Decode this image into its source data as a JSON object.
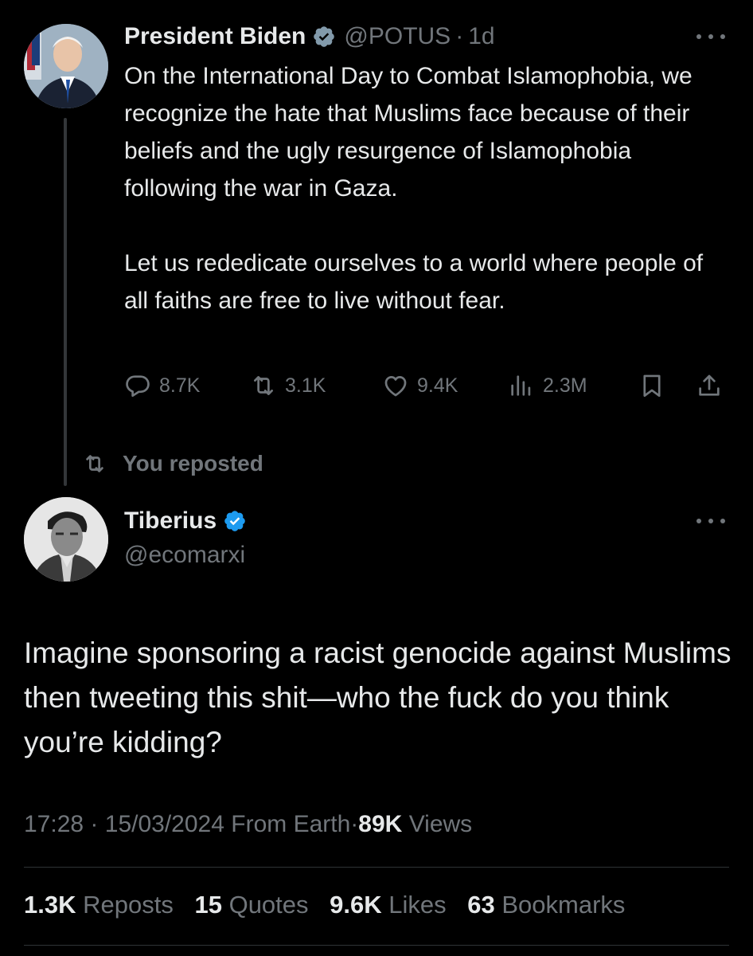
{
  "parent_tweet": {
    "display_name": "President Biden",
    "handle": "@POTUS",
    "separator": "·",
    "time": "1d",
    "text_paragraph_1": "On the International Day to Combat Islamophobia, we recognize the hate that Muslims face because of their beliefs and the ugly resurgence of Islamophobia following the war in Gaza.",
    "text_paragraph_2": "Let us rededicate ourselves to a world where people of all faiths are free to live without fear.",
    "metrics": {
      "replies": "8.7K",
      "reposts": "3.1K",
      "likes": "9.4K",
      "views": "2.3M"
    },
    "verified_badge": "gray-verified-icon"
  },
  "repost_context": {
    "label": "You reposted"
  },
  "main_tweet": {
    "display_name": "Tiberius",
    "handle": "@ecomarxi",
    "verified_badge": "blue-verified-icon",
    "text": "Imagine sponsoring a racist genocide against Muslims then tweeting this shit—who the fuck do you think you’re kidding?",
    "meta": {
      "time": "17:28",
      "separator": "·",
      "date": "15/03/2024",
      "source": "From Earth",
      "separator_2": "·",
      "views_count": "89K",
      "views_label": "Views"
    },
    "stats": {
      "reposts_count": "1.3K",
      "reposts_label": "Reposts",
      "quotes_count": "15",
      "quotes_label": "Quotes",
      "likes_count": "9.6K",
      "likes_label": "Likes",
      "bookmarks_count": "63",
      "bookmarks_label": "Bookmarks"
    }
  },
  "colors": {
    "background": "#000000",
    "text_primary": "#e7e9ea",
    "text_secondary": "#71767b",
    "verified_blue": "#1d9bf0",
    "verified_gray": "#829aab",
    "divider": "#2f3336"
  }
}
